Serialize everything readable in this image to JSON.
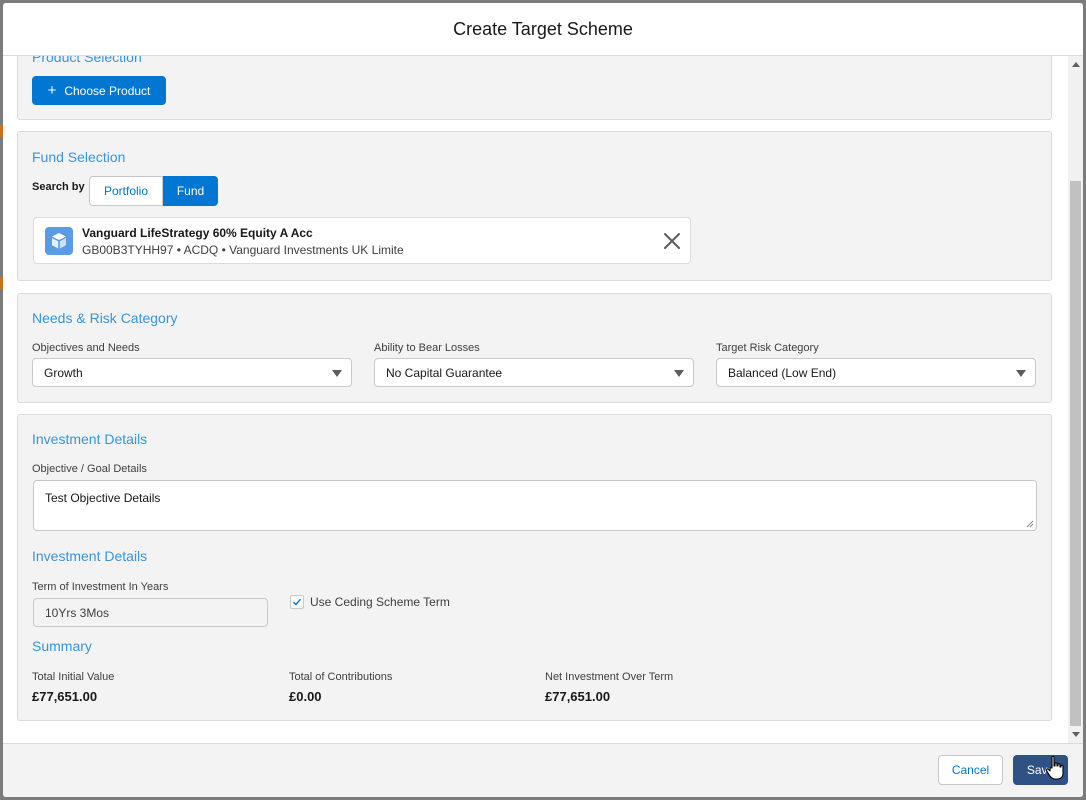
{
  "modal": {
    "title": "Create Target Scheme"
  },
  "product_selection": {
    "title": "Product Selection",
    "choose_button": "Choose Product"
  },
  "fund_selection": {
    "title": "Fund Selection",
    "search_by_label": "Search by",
    "options": [
      "Portfolio",
      "Fund"
    ],
    "selected_option": "Fund",
    "selected_fund": {
      "name": "Vanguard LifeStrategy 60% Equity A Acc",
      "meta": "GB00B3TYHH97 • ACDQ • Vanguard Investments UK Limite"
    }
  },
  "needs_risk": {
    "title": "Needs & Risk Category",
    "fields": [
      {
        "label": "Objectives and Needs",
        "value": "Growth"
      },
      {
        "label": "Ability to Bear Losses",
        "value": "No Capital Guarantee"
      },
      {
        "label": "Target Risk Category",
        "value": "Balanced (Low End)"
      }
    ]
  },
  "investment_details": {
    "title": "Investment Details",
    "objective_label": "Objective / Goal Details",
    "objective_value": "Test Objective Details",
    "subtitle": "Investment Details",
    "term_label": "Term of Investment In Years",
    "term_value": "10Yrs 3Mos",
    "use_ceding_label": "Use Ceding Scheme Term",
    "use_ceding_checked": true
  },
  "summary": {
    "title": "Summary",
    "items": [
      {
        "label": "Total Initial Value",
        "value": "£77,651.00"
      },
      {
        "label": "Total of Contributions",
        "value": "£0.00"
      },
      {
        "label": "Net Investment Over Term",
        "value": "£77,651.00"
      }
    ]
  },
  "footer": {
    "cancel_label": "Cancel",
    "save_label": "Save"
  },
  "colors": {
    "brand": "#0176d3",
    "section_title": "#3a94dc",
    "save": "#2f5186",
    "fund_icon": "#5a9be6"
  }
}
